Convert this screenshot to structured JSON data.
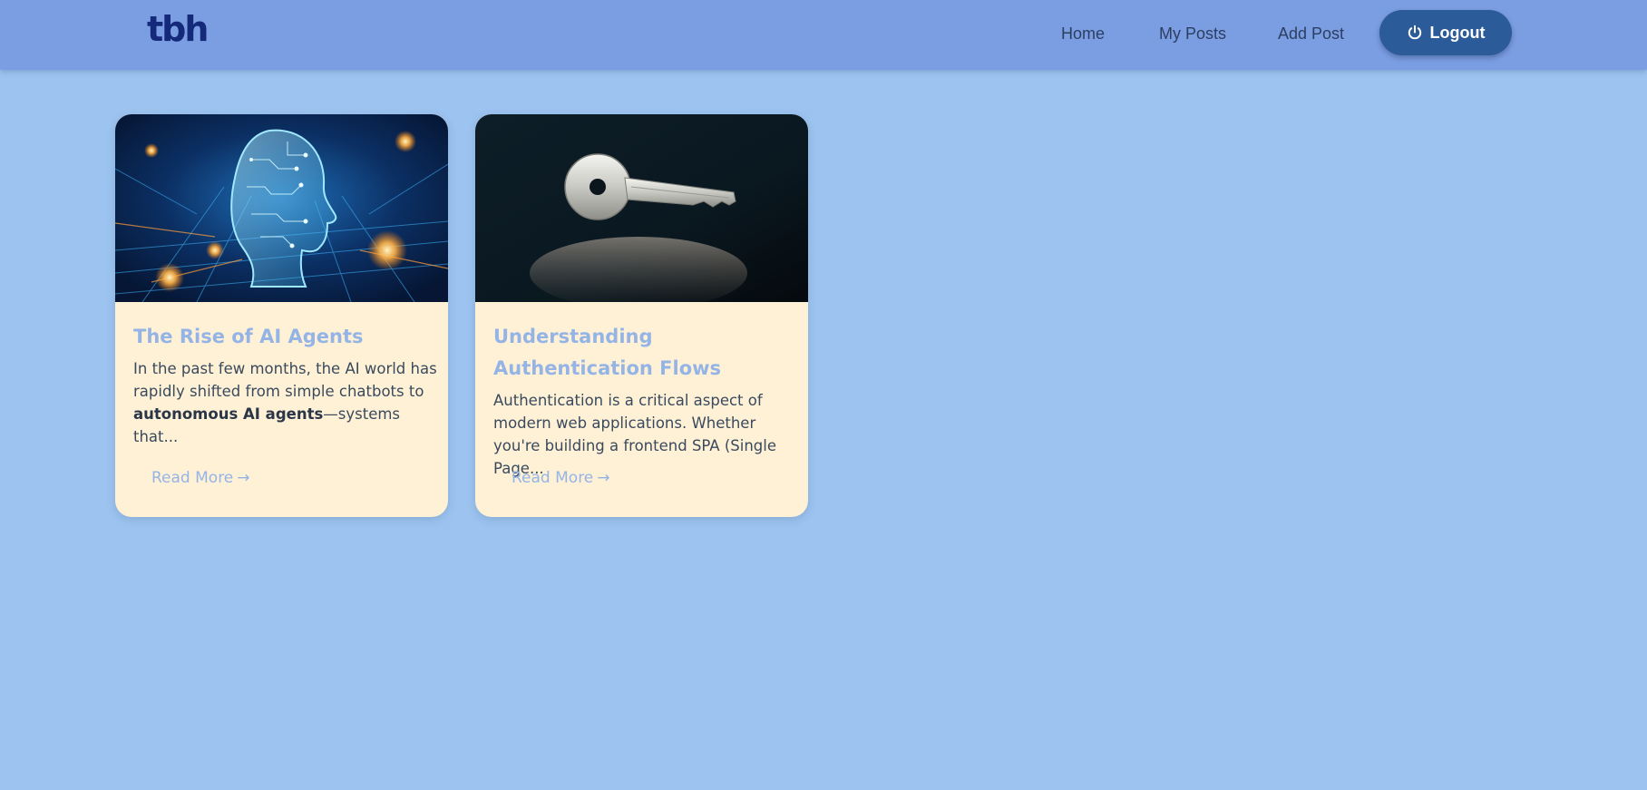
{
  "header": {
    "logo": "tbh",
    "nav": [
      {
        "label": "Home"
      },
      {
        "label": "My Posts"
      },
      {
        "label": "Add Post"
      }
    ],
    "logout_label": "Logout",
    "logout_icon": "power-icon"
  },
  "posts": [
    {
      "image": "ai-head-circuit-image",
      "title": "The Rise of AI Agents",
      "excerpt_before": "In the past few months, the AI world has rapidly shifted from simple chatbots to ",
      "excerpt_bold": "autonomous AI agents",
      "excerpt_after": "—systems that...",
      "read_more": "Read More",
      "arrow": "→"
    },
    {
      "image": "key-image",
      "title": "Understanding Authentication Flows",
      "excerpt": "Authentication is a critical aspect of modern web applications. Whether you're building a frontend SPA (Single Page...",
      "read_more": "Read More",
      "arrow": "→"
    }
  ],
  "colors": {
    "page_bg": "#9dc4f0",
    "navbar_bg": "#7b9de2",
    "logo": "#14297a",
    "logout_bg": "#2b5b98",
    "card_bg": "#fff1d6",
    "card_title": "#95b4e6"
  }
}
